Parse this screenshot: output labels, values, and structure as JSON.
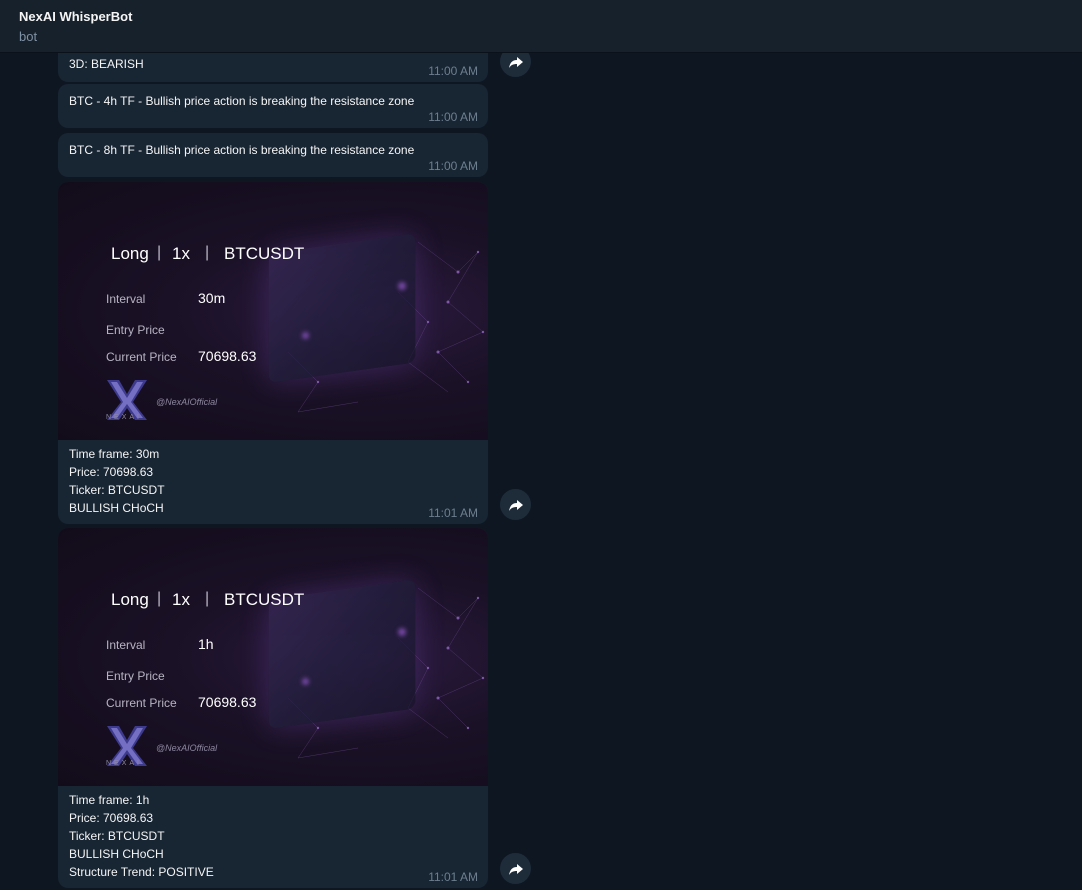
{
  "header": {
    "title": "NexAI WhisperBot",
    "subtitle": "bot"
  },
  "messages": [
    {
      "text": "3D: BEARISH",
      "time": "11:00 AM"
    },
    {
      "text": "BTC - 4h TF - Bullish price action is breaking the resistance zone",
      "time": "11:00 AM"
    },
    {
      "text": "BTC - 8h TF - Bullish price action is breaking the resistance zone",
      "time": "11:00 AM"
    }
  ],
  "cards": [
    {
      "side": "Long",
      "leverage": "1x",
      "pair": "BTCUSDT",
      "interval_label": "Interval",
      "interval": "30m",
      "entry_label": "Entry Price",
      "current_label": "Current Price",
      "current": "70698.63",
      "handle": "@NexAIOfficial",
      "logo_text": "NEXAI",
      "caption": "Time frame: 30m\nPrice: 70698.63\nTicker: BTCUSDT\nBULLISH CHoCH",
      "time": "11:01 AM"
    },
    {
      "side": "Long",
      "leverage": "1x",
      "pair": "BTCUSDT",
      "interval_label": "Interval",
      "interval": "1h",
      "entry_label": "Entry Price",
      "current_label": "Current Price",
      "current": "70698.63",
      "handle": "@NexAIOfficial",
      "logo_text": "NEXAI",
      "caption": "Time frame: 1h\nPrice: 70698.63\nTicker: BTCUSDT\nBULLISH CHoCH\nStructure Trend: POSITIVE",
      "time": "11:01 AM"
    }
  ],
  "icons": {
    "share": "share-arrow-icon",
    "logo": "nexai-logo-icon"
  },
  "colors": {
    "background": "#0e1621",
    "bubble": "#182533",
    "header": "#17212b",
    "time": "#6d7f8f"
  }
}
